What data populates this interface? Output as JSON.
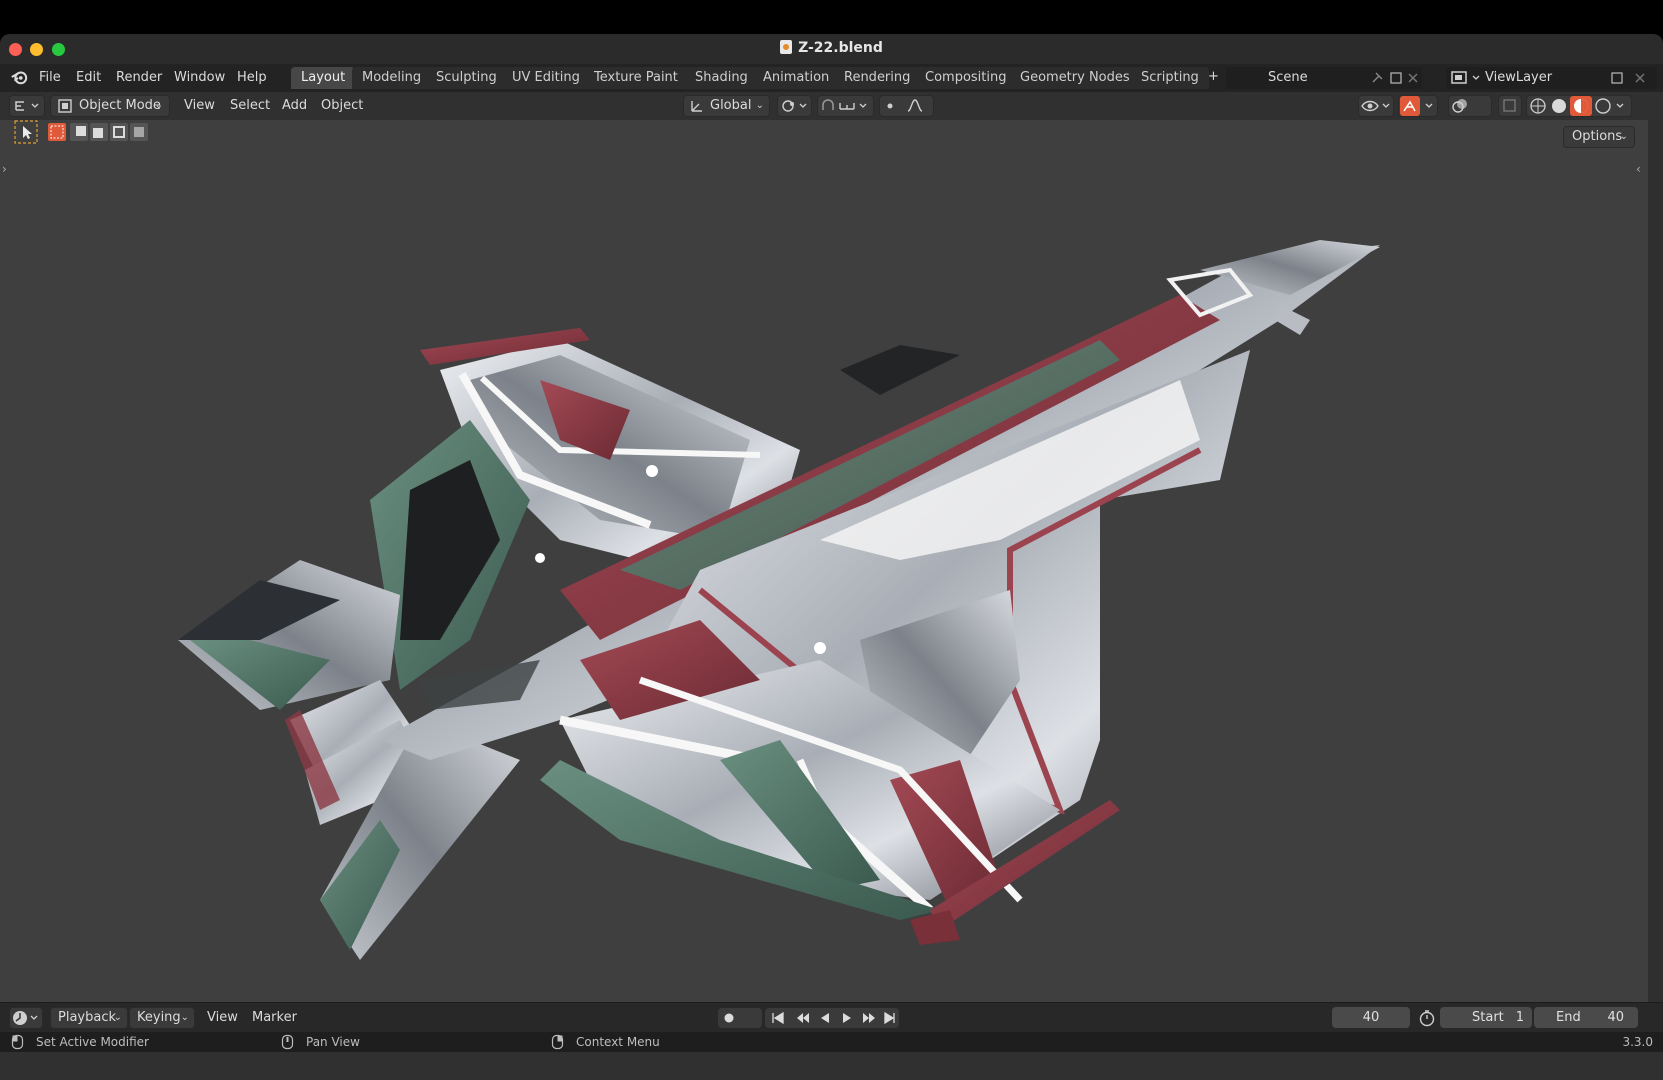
{
  "window": {
    "title": "Z-22.blend"
  },
  "menubar": {
    "items": [
      "File",
      "Edit",
      "Render",
      "Window",
      "Help"
    ],
    "workspaces": [
      "Layout",
      "Modeling",
      "Sculpting",
      "UV Editing",
      "Texture Paint",
      "Shading",
      "Animation",
      "Rendering",
      "Compositing",
      "Geometry Nodes",
      "Scripting"
    ],
    "active_workspace": "Layout",
    "add_tab_label": "+",
    "scene": "Scene",
    "view_layer": "ViewLayer"
  },
  "header": {
    "mode": "Object Mode",
    "menus": [
      "View",
      "Select",
      "Add",
      "Object"
    ],
    "transform_orientation": "Global",
    "options_label": "Options"
  },
  "timeline": {
    "playback_label": "Playback",
    "keying_label": "Keying",
    "view_label": "View",
    "marker_label": "Marker",
    "current_frame": "40",
    "start_label": "Start",
    "start_value": "1",
    "end_label": "End",
    "end_value": "40"
  },
  "statusbar": {
    "left": "Set Active Modifier",
    "middle": "Pan View",
    "right": "Context Menu",
    "version": "3.3.0"
  },
  "colors": {
    "accent_red": "#e05a3a",
    "body_silver": "#c8ccd2",
    "livery_red": "#8c3a44",
    "livery_green": "#557a6b"
  }
}
